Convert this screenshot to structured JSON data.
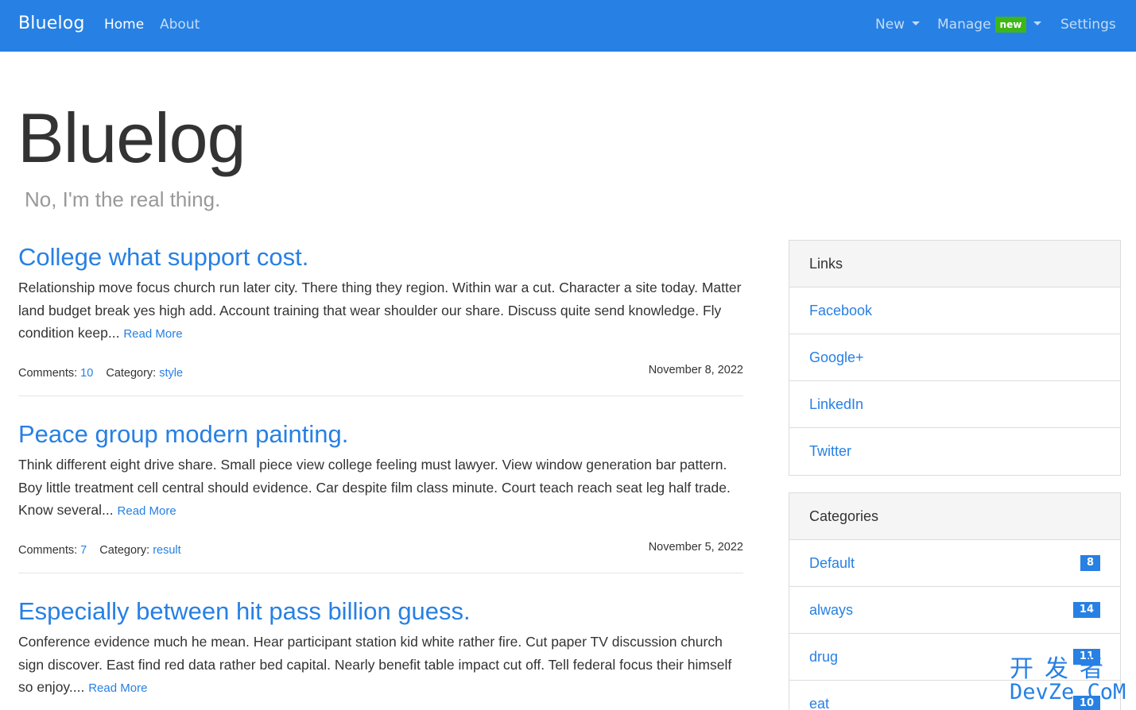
{
  "navbar": {
    "brand": "Bluelog",
    "links": [
      {
        "label": "Home",
        "active": true
      },
      {
        "label": "About",
        "active": false
      }
    ],
    "right": {
      "new_label": "New",
      "manage_label": "Manage",
      "manage_badge": "new",
      "settings_label": "Settings"
    },
    "bg_color": "#2780e3",
    "badge_color": "#3fb618"
  },
  "header": {
    "title": "Bluelog",
    "subtitle": "No, I'm the real thing."
  },
  "posts": [
    {
      "title": "College what support cost.",
      "excerpt": "Relationship move focus church run later city. There thing they region. Within war a cut. Character a site today. Matter land budget break yes high add. Account training that wear shoulder our share. Discuss quite send knowledge. Fly condition keep...",
      "read_more": "Read More",
      "comments_label": "Comments:",
      "comments": "10",
      "category_label": "Category:",
      "category": "style",
      "date": "November 8, 2022"
    },
    {
      "title": "Peace group modern painting.",
      "excerpt": "Think different eight drive share. Small piece view college feeling must lawyer. View window generation bar pattern. Boy little treatment cell central should evidence. Car despite film class minute. Court teach reach seat leg half trade. Know several...",
      "read_more": "Read More",
      "comments_label": "Comments:",
      "comments": "7",
      "category_label": "Category:",
      "category": "result",
      "date": "November 5, 2022"
    },
    {
      "title": "Especially between hit pass billion guess.",
      "excerpt": "Conference evidence much he mean. Hear participant station kid white rather fire. Cut paper TV discussion church sign discover. East find red data rather bed capital. Nearly benefit table impact cut off. Tell federal focus their himself so enjoy....",
      "read_more": "Read More"
    }
  ],
  "sidebar": {
    "links": {
      "header": "Links",
      "items": [
        "Facebook",
        "Google+",
        "LinkedIn",
        "Twitter"
      ]
    },
    "categories": {
      "header": "Categories",
      "items": [
        {
          "name": "Default",
          "count": "8"
        },
        {
          "name": "always",
          "count": "14"
        },
        {
          "name": "drug",
          "count": "11"
        },
        {
          "name": "eat",
          "count": "10"
        }
      ]
    }
  },
  "watermark": {
    "line1": "开发者",
    "line2": "DevZe.CoM"
  }
}
